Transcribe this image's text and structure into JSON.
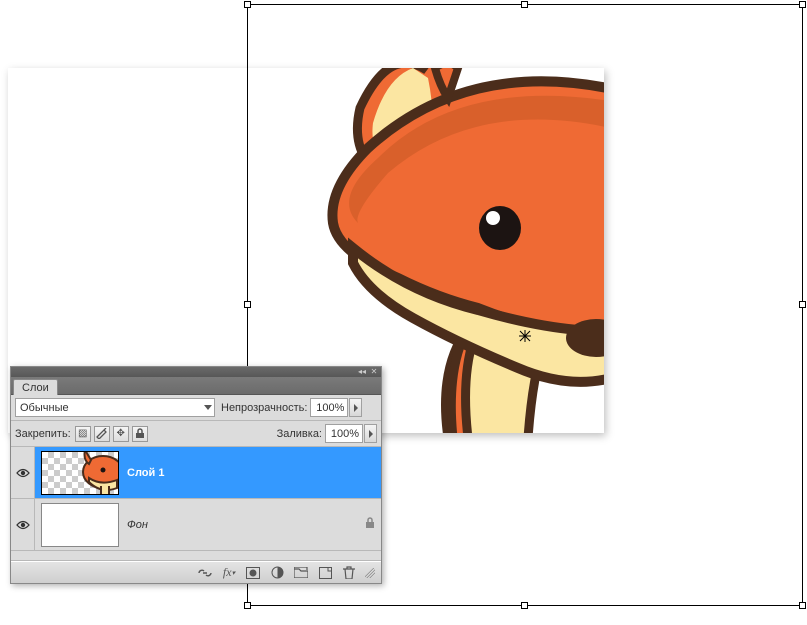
{
  "canvas": {
    "image_subject": "cartoon-fox"
  },
  "layers_panel": {
    "tab_label": "Слои",
    "blend_mode": "Обычные",
    "opacity_label": "Непрозрачность:",
    "opacity_value": "100%",
    "lock_label": "Закрепить:",
    "fill_label": "Заливка:",
    "fill_value": "100%",
    "layers": [
      {
        "name": "Слой 1",
        "visible": true,
        "selected": true,
        "locked": false,
        "thumb": "fox-on-checker"
      },
      {
        "name": "Фон",
        "visible": true,
        "selected": false,
        "locked": true,
        "thumb": "white"
      }
    ],
    "footer_icons": [
      "link",
      "fx",
      "mask",
      "adjustment",
      "group",
      "new-layer",
      "delete"
    ]
  },
  "colors": {
    "selection_blue": "#3499ff",
    "fox_body": "#ef6a34",
    "fox_shadow": "#d9602b",
    "fox_cream": "#fbe6a2",
    "fox_outline": "#4b2d1b"
  }
}
